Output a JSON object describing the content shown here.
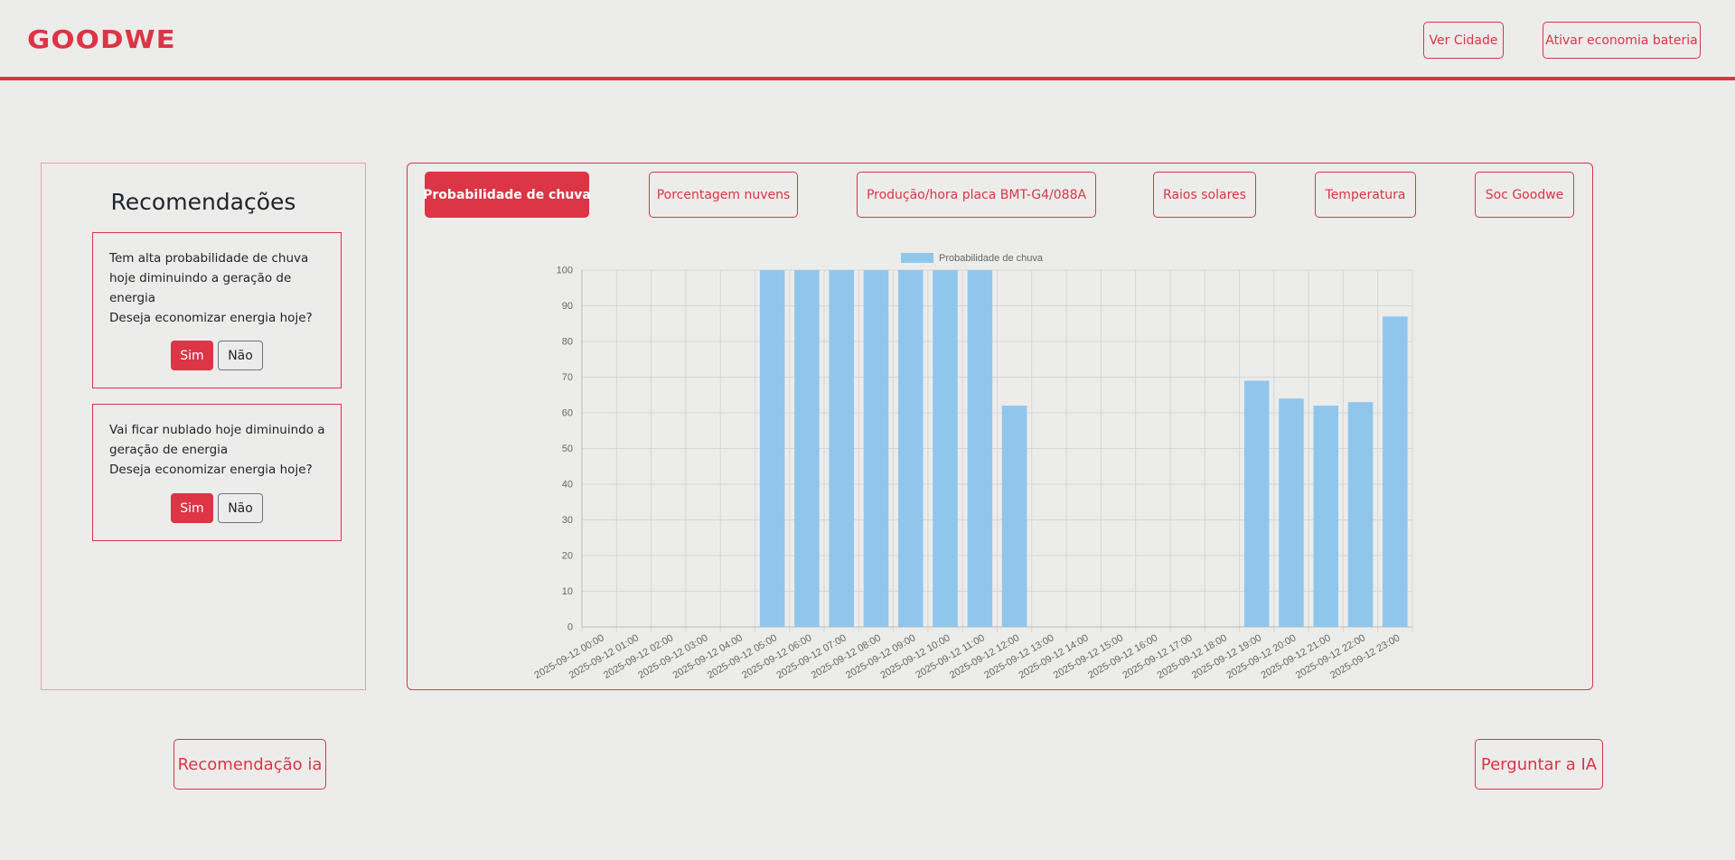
{
  "header": {
    "logo": "GOODWE",
    "buttons": [
      "Ver Cidade",
      "Ativar economia bateria"
    ]
  },
  "recommendations": {
    "title": "Recomendações",
    "cards": [
      {
        "text": "Tem alta probabilidade de chuva\nhoje diminuindo a geração de\nenergia\nDeseja economizar energia hoje?",
        "yes": "Sim",
        "no": "Não"
      },
      {
        "text": "Vai ficar nublado hoje diminuindo a\ngeração de energia\nDeseja economizar energia hoje?",
        "yes": "Sim",
        "no": "Não"
      }
    ]
  },
  "tabs": [
    {
      "label": "Probabilidade de chuva",
      "active": true
    },
    {
      "label": "Porcentagem nuvens",
      "active": false
    },
    {
      "label": "Produção/hora placa BMT-G4/088A",
      "active": false
    },
    {
      "label": "Raios solares",
      "active": false
    },
    {
      "label": "Temperatura",
      "active": false
    },
    {
      "label": "Soc Goodwe",
      "active": false
    }
  ],
  "bottom": {
    "left_button": "Recomendação ia",
    "right_button": "Perguntar a IA"
  },
  "colors": {
    "accent": "#dc3545",
    "bar": "#91c6ec",
    "background": "#ececeb"
  },
  "chart_data": {
    "type": "bar",
    "legend": "top",
    "grid": true,
    "ylim": [
      0,
      100
    ],
    "yticks": [
      0,
      10,
      20,
      30,
      40,
      50,
      60,
      70,
      80,
      90,
      100
    ],
    "categories": [
      "2025-09-12 00:00",
      "2025-09-12 01:00",
      "2025-09-12 02:00",
      "2025-09-12 03:00",
      "2025-09-12 04:00",
      "2025-09-12 05:00",
      "2025-09-12 06:00",
      "2025-09-12 07:00",
      "2025-09-12 08:00",
      "2025-09-12 09:00",
      "2025-09-12 10:00",
      "2025-09-12 11:00",
      "2025-09-12 12:00",
      "2025-09-12 13:00",
      "2025-09-12 14:00",
      "2025-09-12 15:00",
      "2025-09-12 16:00",
      "2025-09-12 17:00",
      "2025-09-12 18:00",
      "2025-09-12 19:00",
      "2025-09-12 20:00",
      "2025-09-12 21:00",
      "2025-09-12 22:00",
      "2025-09-12 23:00"
    ],
    "series": [
      {
        "name": "Probabilidade de chuva",
        "values": [
          0,
          0,
          0,
          0,
          0,
          100,
          100,
          100,
          100,
          100,
          100,
          100,
          62,
          0,
          0,
          0,
          0,
          0,
          0,
          69,
          64,
          62,
          63,
          87
        ]
      }
    ]
  }
}
